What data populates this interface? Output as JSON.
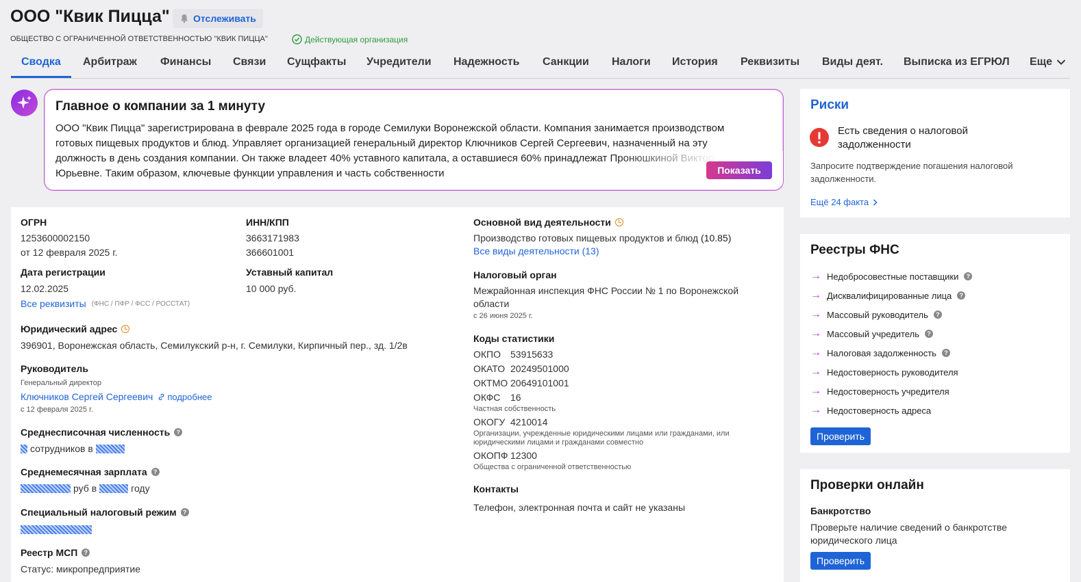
{
  "header": {
    "title": "ООО \"Квик Пицца\"",
    "follow_label": "Отслеживать",
    "full_name": "ОБЩЕСТВО С ОГРАНИЧЕННОЙ ОТВЕТСТВЕННОСТЬЮ \"КВИК ПИЦЦА\"",
    "status": "Действующая организация"
  },
  "tabs": [
    "Сводка",
    "Арбитраж",
    "Финансы",
    "Связи",
    "Сущфакты",
    "Учредители",
    "Надежность",
    "Санкции",
    "Налоги",
    "История",
    "Реквизиты",
    "Виды деят.",
    "Выписка из ЕГРЮЛ",
    "Еще"
  ],
  "summary": {
    "title": "Главное о компании за 1 минуту",
    "text": "ООО \"Квик Пицца\" зарегистрирована в феврале 2025 года в городе Семилуки Воронежской области. Компания занимается производством готовых пищевых продуктов и блюд. Управляет организацией генеральный директор Ключников Сергей Сергеевич, назначенный на эту должность в день создания компании. Он также владеет 40% уставного капитала, а оставшиеся 60% принадлежат Пронюшкиной Виктории Юрьевне. Таким образом, ключевые функции управления и часть собственности",
    "show_label": "Показать"
  },
  "details": {
    "ogrn_label": "ОГРН",
    "ogrn": "1253600002150",
    "ogrn_date": "от 12 февраля 2025 г.",
    "inn_label": "ИНН/КПП",
    "inn": "3663171983",
    "kpp": "366601001",
    "reg_date_label": "Дата регистрации",
    "reg_date": "12.02.2025",
    "all_requisites": "Все реквизиты",
    "requisites_note": "(ФНС / ПФР / ФСС / РОССТАТ)",
    "capital_label": "Уставный капитал",
    "capital": "10 000 руб.",
    "address_label": "Юридический адрес",
    "address": "396901, Воронежская область, Семилукский р-н, г. Семилуки, Кирпичный пер., зд. 1/2в",
    "head_label": "Руководитель",
    "head_position": "Генеральный директор",
    "head_name": "Ключников Сергей Сергеевич",
    "head_more": "подробнее",
    "head_date": "с 12 февраля 2025 г.",
    "staff_label": "Среднесписочная численность",
    "staff_text_1": "сотрудников в",
    "salary_label": "Среднемесячная зарплата",
    "salary_text_1": "руб в",
    "salary_text_2": "году",
    "tax_regime_label": "Специальный налоговый режим",
    "msp_label": "Реестр МСП",
    "msp_status": "Статус: микропредприятие",
    "activity_label": "Основной вид деятельности",
    "activity": "Производство готовых пищевых продуктов и блюд",
    "activity_code": "(10.85)",
    "all_activities": "Все виды деятельности (13)",
    "tax_authority_label": "Налоговый орган",
    "tax_authority_line1": "Межрайонная инспекция ФНС России № 1 по Воронежской",
    "tax_authority_line2": "области",
    "tax_authority_date": "с 26 июня 2025 г.",
    "stat_codes_label": "Коды статистики",
    "okpo_k": "ОКПО",
    "okpo_v": "53915633",
    "okato_k": "ОКАТО",
    "okato_v": "20249501000",
    "oktmo_k": "ОКТМО",
    "oktmo_v": "20649101001",
    "okfs_k": "ОКФС",
    "okfs_v": "16",
    "okfs_note": "Частная собственность",
    "okogu_k": "ОКОГУ",
    "okogu_v": "4210014",
    "okogu_note_1": "Организации, учрежденные юридическими лицами или гражданами, или",
    "okogu_note_2": "юридическими лицами и гражданами совместно",
    "okopf_k": "ОКОПФ",
    "okopf_v": "12300",
    "okopf_note": "Общества с ограниченной ответственностью",
    "contacts_label": "Контакты",
    "contacts": "Телефон, электронная почта и сайт не указаны"
  },
  "risks": {
    "title": "Риски",
    "alert_1": "Есть сведения о налоговой",
    "alert_2": "задолженности",
    "desc_1": "Запросите подтверждение погашения налоговой",
    "desc_2": "задолженности.",
    "more": "Ещё 24 факта"
  },
  "registries": {
    "title": "Реестры ФНС",
    "items": [
      "Недобросовестные поставщики",
      "Дисквалифицированные лица",
      "Массовый руководитель",
      "Массовый учредитель",
      "Налоговая задолженность",
      "Недостоверность руководителя",
      "Недостоверность учредителя",
      "Недостоверность адреса"
    ],
    "check": "Проверить"
  },
  "online": {
    "title": "Проверки онлайн",
    "bankruptcy_label": "Банкротство",
    "desc_1": "Проверьте наличие сведений о банкротстве",
    "desc_2": "юридического лица",
    "check": "Проверить"
  },
  "colors": {
    "accent": "#1f64d6",
    "ai_border": "#c15ad6",
    "danger": "#e53935",
    "ok": "#2e9b3e"
  }
}
